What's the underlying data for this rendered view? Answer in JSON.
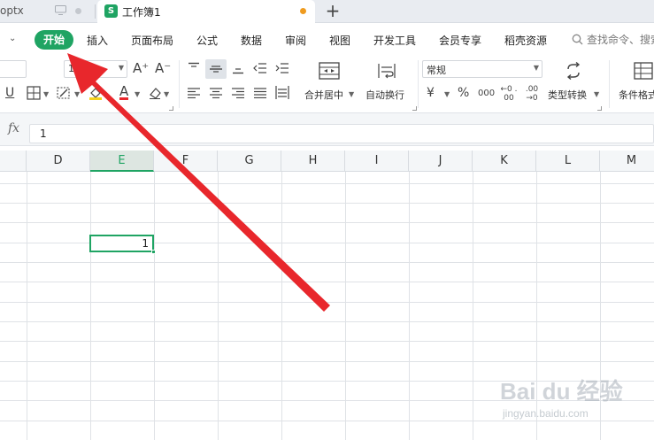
{
  "tabs": {
    "inactive_label": "optx",
    "active_icon": "S",
    "active_label": "工作簿1",
    "new_tab": "+"
  },
  "menu": {
    "chevron": "⌄",
    "active": "开始",
    "items": [
      "插入",
      "页面布局",
      "公式",
      "数据",
      "审阅",
      "视图",
      "开发工具",
      "会员专享",
      "稻壳资源"
    ],
    "search_text": "查找命令、搜索"
  },
  "toolbar": {
    "font_size": "11",
    "number_format": "常规",
    "merge_label": "合并居中",
    "wrap_label": "自动换行",
    "convert_label": "类型转换",
    "cond_label": "条件格式",
    "currency_symbol": "¥",
    "percent_symbol": "%",
    "thousands_symbol": "000",
    "dec_increase": "←0 .00",
    "dec_decrease": ".00 →0",
    "font_color_symbol": "A",
    "grow_symbol": "A⁺",
    "shrink_symbol": "A⁻",
    "underline_symbol": "U"
  },
  "formula_bar": {
    "fx_label": "fx",
    "value": "1"
  },
  "sheet": {
    "columns": [
      "D",
      "E",
      "F",
      "G",
      "H",
      "I",
      "J",
      "K",
      "L",
      "M"
    ],
    "selected_column": "E",
    "selected_cell_value": "1"
  },
  "watermark": {
    "logo": "Bai du 经验",
    "sub": "jingyan.baidu.com"
  },
  "colors": {
    "accent": "#1fa463",
    "arrow": "#e8272c",
    "tab_unsaved_dot": "#ef9b1f"
  },
  "icons": [
    "monitor-icon",
    "sheet-file-icon",
    "plus-icon",
    "search-icon",
    "align-top-icon",
    "align-middle-icon",
    "align-bottom-icon",
    "merge-center-icon",
    "wrap-text-icon",
    "convert-type-icon",
    "conditional-format-icon",
    "borders-icon",
    "fill-color-icon",
    "clear-icon"
  ]
}
